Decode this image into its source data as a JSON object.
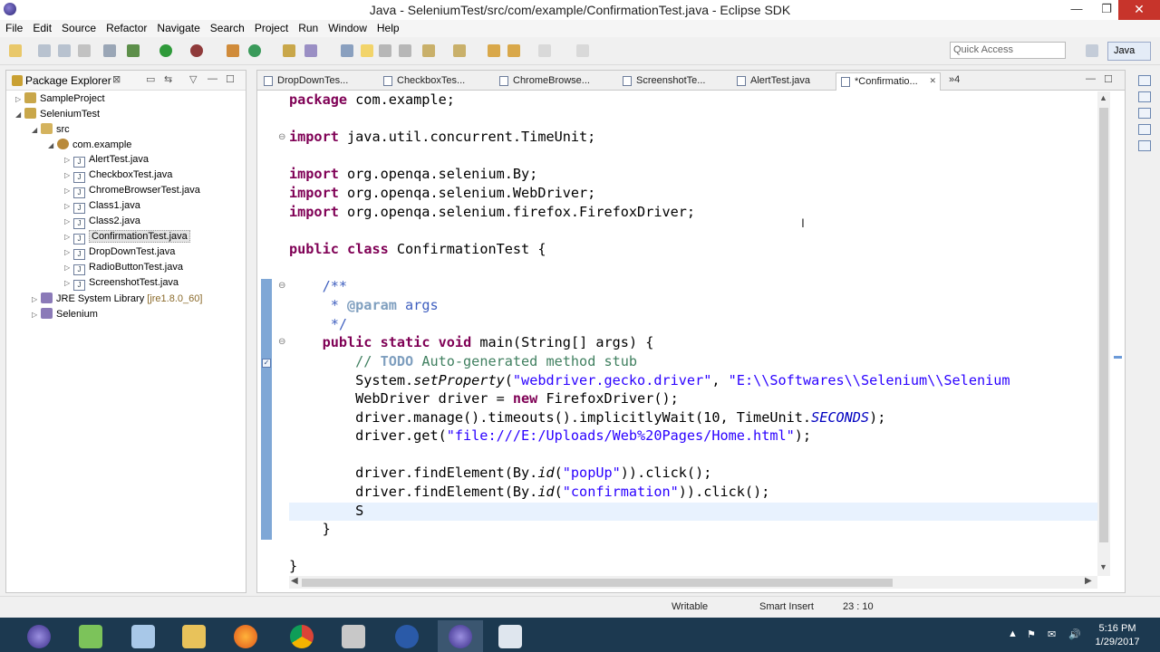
{
  "window": {
    "title": "Java - SeleniumTest/src/com/example/ConfirmationTest.java - Eclipse SDK",
    "minimize_glyph": "—",
    "restore_glyph": "❐",
    "close_glyph": "✕"
  },
  "menu": [
    "File",
    "Edit",
    "Source",
    "Refactor",
    "Navigate",
    "Search",
    "Project",
    "Run",
    "Window",
    "Help"
  ],
  "toolbar": {
    "quick_access_placeholder": "Quick Access",
    "perspective_label": "Java"
  },
  "package_explorer": {
    "title": "Package Explorer",
    "close_glyph": "⊠",
    "items": [
      {
        "label": "SampleProject",
        "arrow": "▷"
      },
      {
        "label": "SeleniumTest",
        "arrow": "◢"
      },
      {
        "label": "src",
        "arrow": "◢"
      },
      {
        "label": "com.example",
        "arrow": "◢"
      },
      {
        "label": "AlertTest.java",
        "arrow": "▷"
      },
      {
        "label": "CheckboxTest.java",
        "arrow": "▷"
      },
      {
        "label": "ChromeBrowserTest.java",
        "arrow": "▷"
      },
      {
        "label": "Class1.java",
        "arrow": "▷"
      },
      {
        "label": "Class2.java",
        "arrow": "▷"
      },
      {
        "label": "ConfirmationTest.java",
        "arrow": "▷"
      },
      {
        "label": "DropDownTest.java",
        "arrow": "▷"
      },
      {
        "label": "RadioButtonTest.java",
        "arrow": "▷"
      },
      {
        "label": "ScreenshotTest.java",
        "arrow": "▷"
      },
      {
        "label": "JRE System Library",
        "suffix": "[jre1.8.0_60]",
        "arrow": "▷"
      },
      {
        "label": "Selenium",
        "arrow": "▷"
      }
    ]
  },
  "editor": {
    "tabs": [
      "DropDownTes...",
      "CheckboxTes...",
      "ChromeBrowse...",
      "ScreenshotTe...",
      "AlertTest.java",
      "*Confirmatio..."
    ],
    "tab_close_glyph": "✕",
    "more_tabs": "»4",
    "code": {
      "l1": [
        "package",
        " com.example;"
      ],
      "l3": [
        "import",
        " java.util.concurrent.TimeUnit;"
      ],
      "l5": [
        "import",
        " org.openqa.selenium.By;"
      ],
      "l6": [
        "import",
        " org.openqa.selenium.WebDriver;"
      ],
      "l7": [
        "import",
        " org.openqa.selenium.firefox.FirefoxDriver;"
      ],
      "l9": [
        "public",
        " ",
        "class",
        " ConfirmationTest {"
      ],
      "l11": "    /**",
      "l12": [
        "     * ",
        "@param",
        " args"
      ],
      "l13": "     */",
      "l14": [
        "    ",
        "public",
        " ",
        "static",
        " ",
        "void",
        " main(String[] args) {"
      ],
      "l15": [
        "        // ",
        "TODO",
        " Auto-generated method stub"
      ],
      "l16": [
        "        System.",
        "setProperty",
        "(",
        "\"webdriver.gecko.driver\"",
        ", ",
        "\"E:\\\\Softwares\\\\Selenium\\\\Selenium"
      ],
      "l17": [
        "        WebDriver driver = ",
        "new",
        " FirefoxDriver();"
      ],
      "l18": [
        "        driver.manage().timeouts().implicitlyWait(10, TimeUnit.",
        "SECONDS",
        ");"
      ],
      "l19": [
        "        driver.get(",
        "\"file:///E:/Uploads/Web%20Pages/Home.html\"",
        ");"
      ],
      "l21": [
        "        driver.findElement(By.",
        "id",
        "(",
        "\"popUp\"",
        ")).click();"
      ],
      "l22": [
        "        driver.findElement(By.",
        "id",
        "(",
        "\"confirmation\"",
        ")).click();"
      ],
      "l23": "        S",
      "l24": "    }",
      "l26": "}"
    }
  },
  "status": {
    "writable": "Writable",
    "insert_mode": "Smart Insert",
    "position": "23 : 10"
  },
  "taskbar": {
    "time": "5:16 PM",
    "date": "1/29/2017",
    "tray_glyphs": [
      "▲",
      "⚑",
      "✉",
      "🔊"
    ]
  },
  "colors": {
    "keyword": "#7f0055",
    "string": "#2a00ff",
    "comment": "#3f7f5f",
    "javadoc": "#3f5fbf",
    "current_line": "#e8f2fe",
    "taskbar": "#1c3950"
  }
}
